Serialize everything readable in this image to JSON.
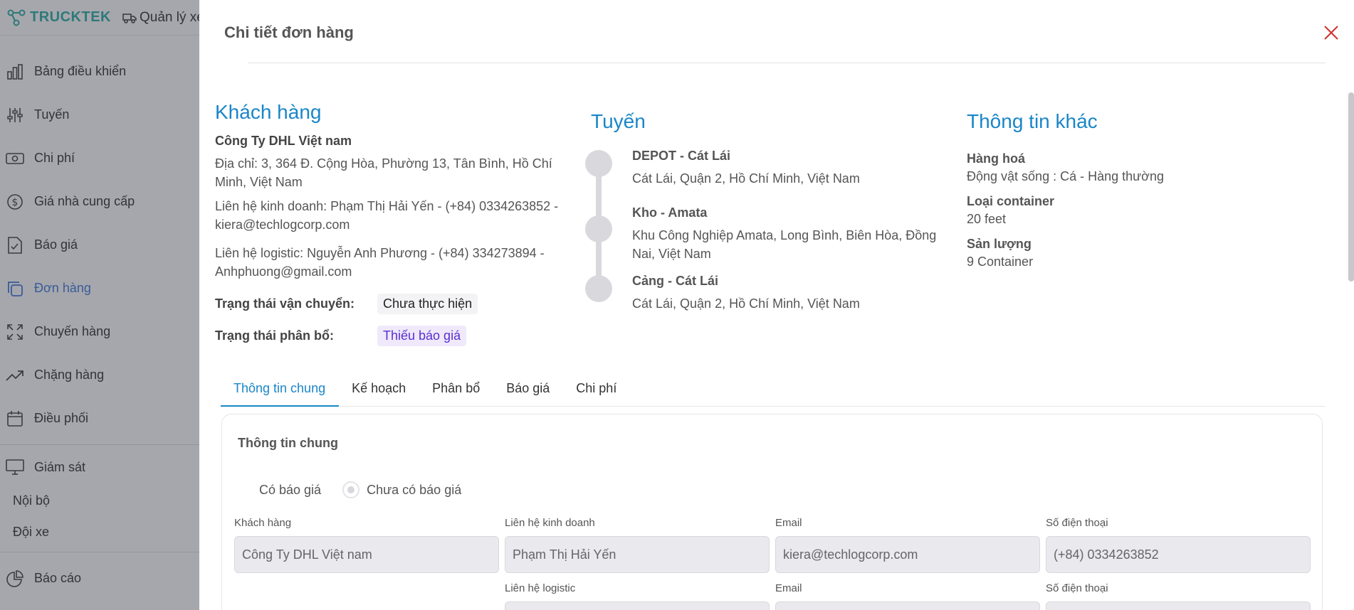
{
  "app": {
    "logo": "TRUCKTEK",
    "top_nav": "Quản lý xe"
  },
  "sidebar": {
    "items": [
      {
        "label": "Bảng điều khiển"
      },
      {
        "label": "Tuyến"
      },
      {
        "label": "Chi phí"
      },
      {
        "label": "Giá nhà cung cấp"
      },
      {
        "label": "Báo giá"
      },
      {
        "label": "Đơn hàng"
      },
      {
        "label": "Chuyến hàng"
      },
      {
        "label": "Chặng hàng"
      },
      {
        "label": "Điều phối"
      },
      {
        "label": "Giám sát"
      }
    ],
    "sub_items": [
      {
        "label": "Nội bộ"
      },
      {
        "label": "Đội xe"
      }
    ],
    "report": "Báo cáo",
    "active_color": "#2f6fd8"
  },
  "drawer": {
    "title": "Chi tiết đơn hàng",
    "customer": {
      "heading": "Khách hàng",
      "name": "Công Ty DHL Việt nam",
      "address": "Địa chỉ: 3, 364 Đ. Cộng Hòa, Phường 13, Tân Bình, Hồ Chí Minh, Việt Nam",
      "sales_contact": "Liên hệ kinh doanh: Phạm Thị Hải Yến - (+84) 0334263852 - kiera@techlogcorp.com",
      "logistic_contact": "Liên hệ logistic: Nguyễn Anh Phương - (+84) 334273894 - Anhphuong@gmail.com",
      "shipping_status_label": "Trạng thái vận chuyển:",
      "shipping_status": "Chưa thực hiện",
      "allocation_status_label": "Trạng thái phân bổ:",
      "allocation_status": "Thiếu báo giá"
    },
    "route": {
      "heading": "Tuyến",
      "stops": [
        {
          "name": "DEPOT - Cát Lái",
          "address": "Cát Lái, Quận 2, Hồ Chí Minh, Việt Nam"
        },
        {
          "name": "Kho - Amata",
          "address": "Khu Công Nghiệp Amata, Long Bình, Biên Hòa, Đồng Nai, Việt Nam"
        },
        {
          "name": "Cảng - Cát Lái",
          "address": "Cát Lái, Quận 2, Hồ Chí Minh, Việt Nam"
        }
      ]
    },
    "other": {
      "heading": "Thông tin khác",
      "goods_label": "Hàng hoá",
      "goods": "Động vật sống : Cá - Hàng thường",
      "container_label": "Loại container",
      "container": "20 feet",
      "volume_label": "Sản lượng",
      "volume": "9 Container"
    },
    "tabs": [
      {
        "label": "Thông tin chung"
      },
      {
        "label": "Kế hoạch"
      },
      {
        "label": "Phân bổ"
      },
      {
        "label": "Báo giá"
      },
      {
        "label": "Chi phí"
      }
    ],
    "general": {
      "title": "Thông tin chung",
      "radio_yes": "Có báo giá",
      "radio_no": "Chưa có báo giá",
      "customer_label": "Khách hàng",
      "customer_value": "Công Ty DHL Việt nam",
      "sales_label": "Liên hệ kinh doanh",
      "sales_value": "Phạm Thị Hải Yến",
      "email_label": "Email",
      "email_value": "kiera@techlogcorp.com",
      "phone_label": "Số điện thoại",
      "phone_value": "(+84) 0334263852",
      "logistic_label": "Liên hệ logistic",
      "email2_label": "Email",
      "phone2_label": "Số điện thoại"
    }
  },
  "colors": {
    "accent": "#1a86c8",
    "close": "#d0322f",
    "tag_purple": "#5b2ecf"
  }
}
